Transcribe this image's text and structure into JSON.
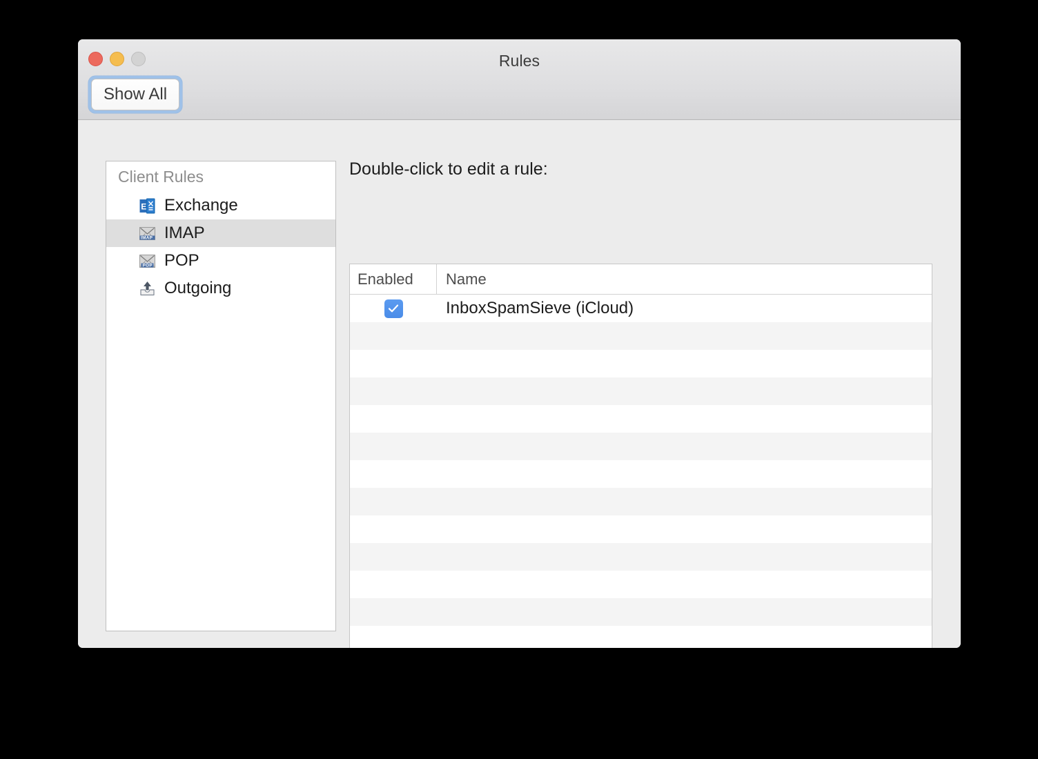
{
  "window": {
    "title": "Rules",
    "traffic_lights": [
      "close-button",
      "minimize-button",
      "zoom-button"
    ]
  },
  "toolbar": {
    "show_all_label": "Show All"
  },
  "sidebar": {
    "header": "Client Rules",
    "items": [
      {
        "label": "Exchange",
        "icon": "exchange-icon",
        "selected": false
      },
      {
        "label": "IMAP",
        "icon": "imap-icon",
        "selected": true
      },
      {
        "label": "POP",
        "icon": "pop-icon",
        "selected": false
      },
      {
        "label": "Outgoing",
        "icon": "outgoing-icon",
        "selected": false
      }
    ]
  },
  "main": {
    "instruction": "Double-click to edit a rule:",
    "columns": [
      "Enabled",
      "Name"
    ],
    "rules": [
      {
        "enabled": true,
        "name": "InboxSpamSieve (iCloud)"
      }
    ],
    "empty_row_count": 13,
    "bottom_toolbar": {
      "add_label": "+",
      "remove_label": "—",
      "move_up_label": "move-up",
      "move_down_label": "move-down"
    }
  },
  "colors": {
    "accent": "#4a8ce8",
    "selection": "#dedede",
    "focus_ring": "#9fc1e8",
    "window_bg": "#ececec"
  }
}
